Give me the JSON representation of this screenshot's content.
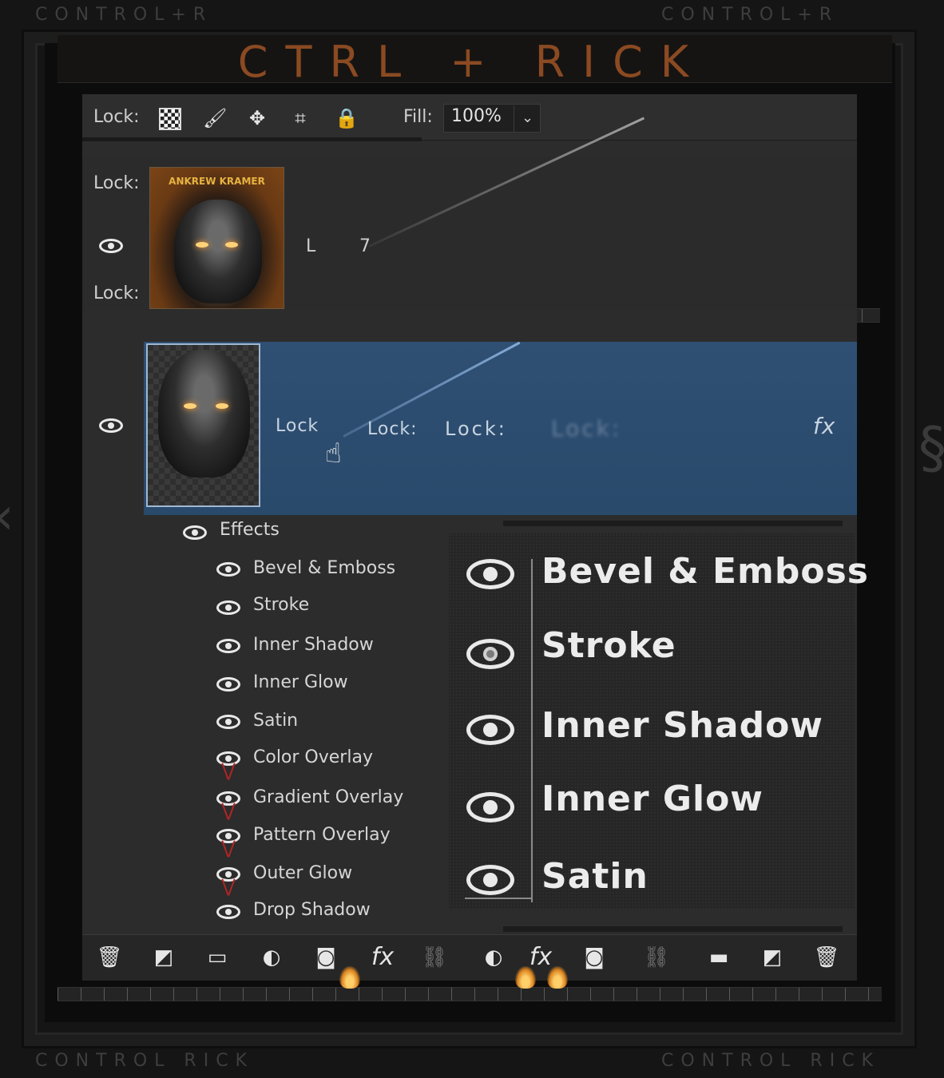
{
  "corners": {
    "top_left": "CONTROL+R",
    "top_right": "CONTROL+R",
    "bottom_left": "CONTROL RICK",
    "bottom_right": "CONTROL RICK"
  },
  "title": "CTRL + RICK",
  "lock_bar": {
    "lock_label": "Lock:",
    "fill_label": "Fill:",
    "fill_value": "100%"
  },
  "layer1": {
    "lock_top": "Lock:",
    "lock_bottom": "Lock:",
    "thumb_caption": "ANKREW KRAMER",
    "name_fragment_a": "L",
    "name_fragment_b": "7"
  },
  "layer2": {
    "text_a": "Lock",
    "text_b": "Lock:",
    "text_c": "Lock:",
    "text_blur": "Lock:",
    "fx": "fx"
  },
  "effects": {
    "title": "Effects",
    "items": [
      "Bevel & Emboss",
      "Stroke",
      "Inner Shadow",
      "Inner Glow",
      "Satin",
      "Color Overlay",
      "Gradient Overlay",
      "Pattern Overlay",
      "Outer Glow",
      "Drop Shadow"
    ]
  },
  "zoomed_effects": [
    "Bevel & Emboss",
    "Stroke",
    "Inner Shadow",
    "Inner Glow",
    "Satin"
  ],
  "bottom_toolbar": {
    "fx_a": "fx",
    "fx_b": "fx"
  },
  "icons": {
    "lock_tools": [
      "lock-transparent-icon",
      "lock-brush-icon",
      "lock-move-icon",
      "lock-artboard-icon",
      "lock-all-icon"
    ],
    "bottom": [
      "trash-icon",
      "new-layer-icon",
      "folder-icon",
      "adjustment-icon",
      "mask-icon",
      "fx-icon",
      "link-icon",
      "adjustment-icon",
      "fx-icon",
      "mask-icon",
      "link-icon",
      "folder-icon",
      "new-layer-icon",
      "trash-icon"
    ]
  },
  "colors": {
    "title": "#8b4a22",
    "selected_layer": "#2f4f73",
    "panel": "#2c2c2c",
    "red_marks": "#b02525"
  }
}
